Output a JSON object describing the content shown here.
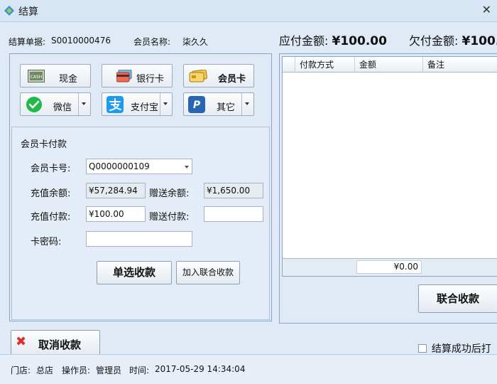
{
  "window": {
    "title": "结算"
  },
  "header": {
    "order_label": "结算单据:",
    "order_no": "S0010000476",
    "member_label": "会员名称:",
    "member_name": "柒久久",
    "due_label": "应付金额:",
    "due_amount": "¥100.00",
    "owed_label": "欠付金额:",
    "owed_amount": "¥100."
  },
  "pay_methods": {
    "cash": "现金",
    "bank": "银行卡",
    "member": "会员卡",
    "wechat": "微信",
    "alipay": "支付宝",
    "other": "其它",
    "cash_icon_text": "CASH"
  },
  "member_form": {
    "title": "会员卡付款",
    "card_no_label": "会员卡号:",
    "card_no_value": "Q0000000109",
    "balance_label": "充值余额:",
    "balance_value": "¥57,284.94",
    "gift_balance_label": "赠送余额:",
    "gift_balance_value": "¥1,650.00",
    "pay_label": "充值付款:",
    "pay_value": "¥100.00",
    "gift_pay_label": "赠送付款:",
    "gift_pay_value": "",
    "pwd_label": "卡密码:",
    "pwd_value": "",
    "single_pay": "单选收款",
    "add_combined": "加入联合收款"
  },
  "grid": {
    "columns": [
      "付款方式",
      "金额",
      "备注"
    ],
    "rows": [],
    "total": "¥0.00"
  },
  "combined_pay": "联合收款",
  "cancel_pay": "取消收款",
  "print_checkbox": {
    "label": "结算成功后打",
    "checked": false
  },
  "status": {
    "store_label": "门店:",
    "store": "总店",
    "operator_label": "操作员:",
    "operator": "管理员",
    "time_label": "时间:",
    "time": "2017-05-29 14:34:04"
  },
  "colors": {
    "accent": "#dfeaf6",
    "cancel_x": "#d9302a"
  }
}
